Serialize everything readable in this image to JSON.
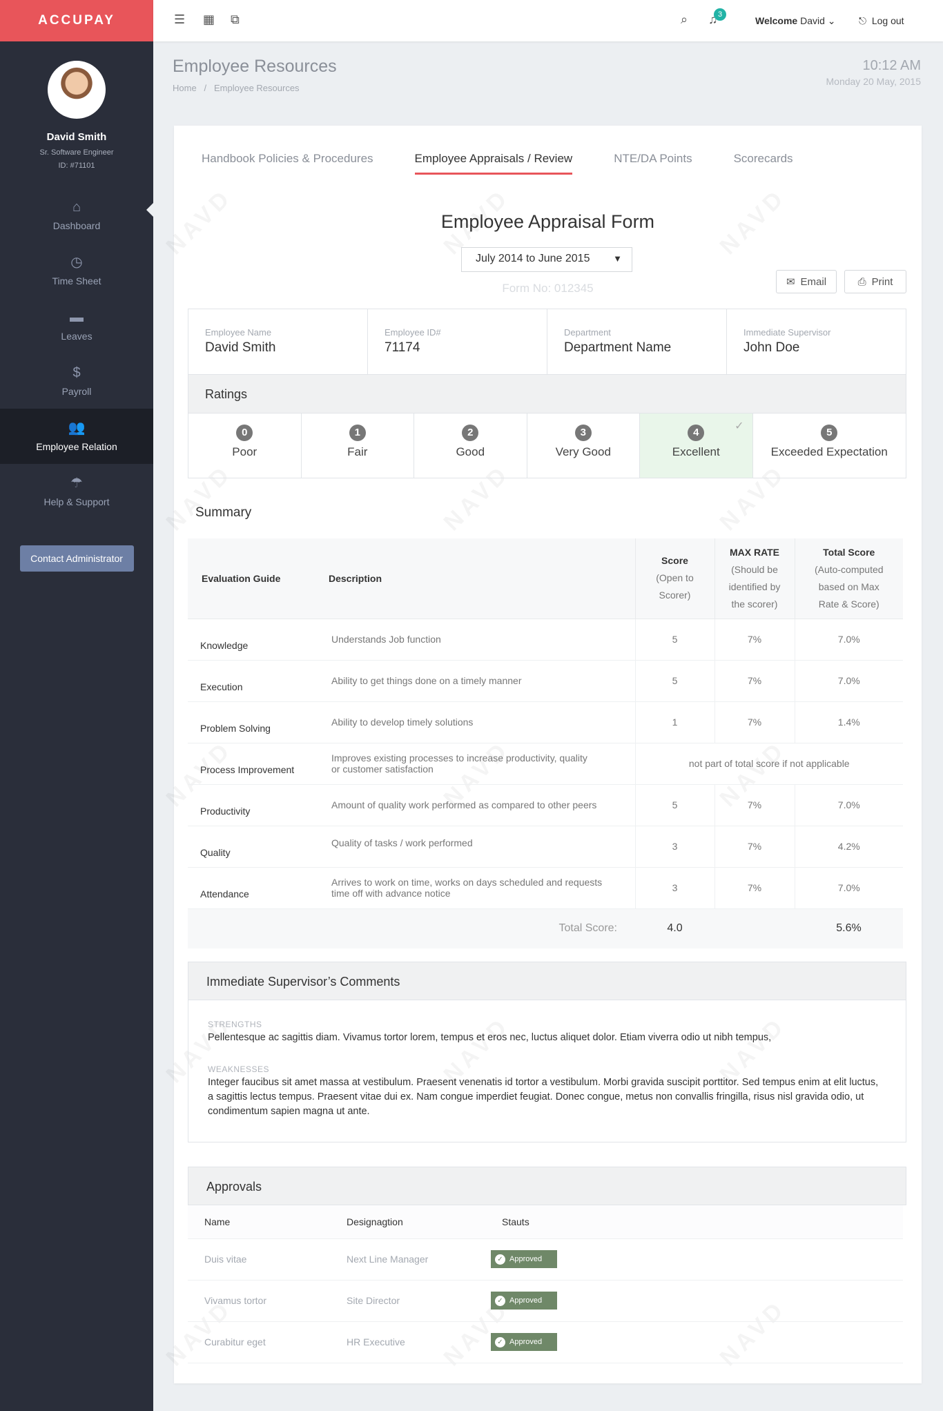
{
  "brand": "ACCUPAY",
  "profile": {
    "name": "David Smith",
    "title": "Sr. Software Engineer",
    "id": "ID: #71101"
  },
  "nav": [
    {
      "label": "Dashboard",
      "icon": "home-icon",
      "glyph": "⌂"
    },
    {
      "label": "Time Sheet",
      "icon": "clock-icon",
      "glyph": "◷"
    },
    {
      "label": "Leaves",
      "icon": "bed-icon",
      "glyph": "▬"
    },
    {
      "label": "Payroll",
      "icon": "dollar-icon",
      "glyph": "$"
    },
    {
      "label": "Employee Relation",
      "icon": "users-icon",
      "glyph": "👥"
    },
    {
      "label": "Help & Support",
      "icon": "umbrella-icon",
      "glyph": "☂"
    }
  ],
  "contact_button": "Contact Administrator",
  "topbar": {
    "notification_count": "3",
    "welcome_prefix": "Welcome",
    "welcome_user": "David",
    "logout": "Log out"
  },
  "header": {
    "title": "Employee Resources",
    "breadcrumb_home": "Home",
    "breadcrumb_sep": "/",
    "breadcrumb_current": "Employee Resources",
    "time": "10:12 AM",
    "date": "Monday 20 May, 2015"
  },
  "tabs": [
    "Handbook Policies & Procedures",
    "Employee Appraisals / Review",
    "NTE/DA Points",
    "Scorecards"
  ],
  "form": {
    "title": "Employee Appraisal Form",
    "period": "July 2014 to June 2015",
    "form_no": "Form No: 012345",
    "email_label": "Email",
    "print_label": "Print"
  },
  "info": [
    {
      "label": "Employee Name",
      "value": "David Smith"
    },
    {
      "label": "Employee ID#",
      "value": "71174"
    },
    {
      "label": "Department",
      "value": "Department Name"
    },
    {
      "label": "Immediate Supervisor",
      "value": "John Doe"
    }
  ],
  "ratings": {
    "title": "Ratings",
    "items": [
      {
        "num": "0",
        "label": "Poor"
      },
      {
        "num": "1",
        "label": "Fair"
      },
      {
        "num": "2",
        "label": "Good"
      },
      {
        "num": "3",
        "label": "Very Good"
      },
      {
        "num": "4",
        "label": "Excellent"
      },
      {
        "num": "5",
        "label": "Exceeded Expectation"
      }
    ],
    "selected": "Excellent"
  },
  "summary": {
    "title": "Summary",
    "headers": {
      "guide": "Evaluation Guide",
      "description": "Description",
      "score_title": "Score",
      "score_sub1": "(Open to",
      "score_sub2": "Scorer)",
      "max_title": "MAX RATE",
      "max_sub1": "(Should be",
      "max_sub2": "identified by",
      "max_sub3": "the scorer)",
      "total_title": "Total Score",
      "total_sub1": "(Auto-computed",
      "total_sub2": "based on Max",
      "total_sub3": "Rate & Score)"
    },
    "rows": [
      {
        "guide": "Knowledge",
        "description": "Understands Job function",
        "score": "5",
        "max": "7%",
        "total": "7.0%"
      },
      {
        "guide": "Execution",
        "description": "Ability to get things done on a timely manner",
        "score": "5",
        "max": "7%",
        "total": "7.0%"
      },
      {
        "guide": "Problem Solving",
        "description": "Ability to develop timely solutions",
        "score": "1",
        "max": "7%",
        "total": "1.4%"
      },
      {
        "guide": "Process Improvement",
        "description": "Improves existing processes to increase productivity, quality or customer satisfaction",
        "note": "not part of total score if not applicable"
      },
      {
        "guide": "Productivity",
        "description": "Amount of quality work performed as compared to other peers",
        "score": "5",
        "max": "7%",
        "total": "7.0%"
      },
      {
        "guide": "Quality",
        "description": "Quality of tasks / work performed",
        "score": "3",
        "max": "7%",
        "total": "4.2%"
      },
      {
        "guide": "Attendance",
        "description": "Arrives to work on time, works on days scheduled and requests time off with advance notice",
        "score": "3",
        "max": "7%",
        "total": "7.0%"
      }
    ],
    "total_label": "Total Score:",
    "total_score": "4.0",
    "total_percent": "5.6%"
  },
  "comments": {
    "title": "Immediate Supervisor’s Comments",
    "strengths_label": "STRENGTHS",
    "strengths": "Pellentesque ac sagittis diam. Vivamus tortor lorem, tempus et eros nec, luctus aliquet dolor. Etiam viverra odio ut nibh tempus,",
    "weaknesses_label": "WEAKNESSES",
    "weaknesses": "Integer faucibus sit amet massa at vestibulum. Praesent venenatis id tortor a vestibulum. Morbi gravida suscipit porttitor. Sed tempus enim at elit luctus, a sagittis lectus tempus. Praesent vitae dui ex. Nam congue imperdiet feugiat. Donec congue, metus non convallis fringilla, risus nisl gravida odio, ut condimentum sapien magna ut ante."
  },
  "approvals": {
    "title": "Approvals",
    "headers": {
      "name": "Name",
      "designation": "Designagtion",
      "status": "Stauts"
    },
    "rows": [
      {
        "name": "Duis vitae",
        "designation": "Next Line Manager",
        "status": "Approved"
      },
      {
        "name": "Vivamus tortor",
        "designation": "Site Director",
        "status": "Approved"
      },
      {
        "name": "Curabitur eget",
        "designation": "HR Executive",
        "status": "Approved"
      }
    ]
  },
  "watermark": "NAVD",
  "colors": {
    "brand": "#e8555a",
    "sidebar": "#2a2e3a",
    "approved": "#6f8868",
    "badge": "#22b3a6",
    "selected_rating": "#e9f6ea"
  }
}
